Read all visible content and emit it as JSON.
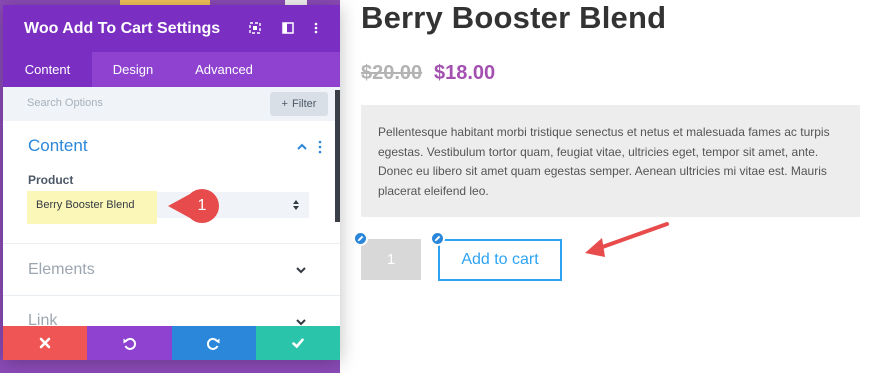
{
  "panel": {
    "title": "Woo Add To Cart Settings",
    "tabs": [
      {
        "label": "Content",
        "active": true
      },
      {
        "label": "Design",
        "active": false
      },
      {
        "label": "Advanced",
        "active": false
      }
    ],
    "search_placeholder": "Search Options",
    "filter_label": "Filter",
    "content_section": {
      "title": "Content",
      "field_label": "Product",
      "selected_value": "Berry Booster Blend"
    },
    "callout_number": "1",
    "collapsed_sections": [
      "Elements",
      "Link"
    ],
    "footer_icons": [
      "close-icon",
      "undo-icon",
      "redo-icon",
      "check-icon"
    ]
  },
  "product": {
    "title": "Berry Booster Blend",
    "price_old": "$20.00",
    "price_new": "$18.00",
    "description": "Pellentesque habitant morbi tristique senectus et netus et malesuada fames ac turpis egestas. Vestibulum tortor quam, feugiat vitae, ultricies eget, tempor sit amet, ante. Donec eu libero sit amet quam egestas semper. Aenean ultricies mi vitae est. Mauris placerat eleifend leo.",
    "quantity": "1",
    "add_to_cart_label": "Add to cart"
  },
  "colors": {
    "header_purple": "#7b2fc2",
    "tab_purple": "#8e42cf",
    "accent_blue": "#2b87da",
    "button_blue": "#2ea3f2",
    "sale_price": "#a350b0",
    "callout_red": "#e84b4b",
    "footer": [
      "#ef5555",
      "#8e42cf",
      "#2b87da",
      "#29c4a9"
    ]
  }
}
